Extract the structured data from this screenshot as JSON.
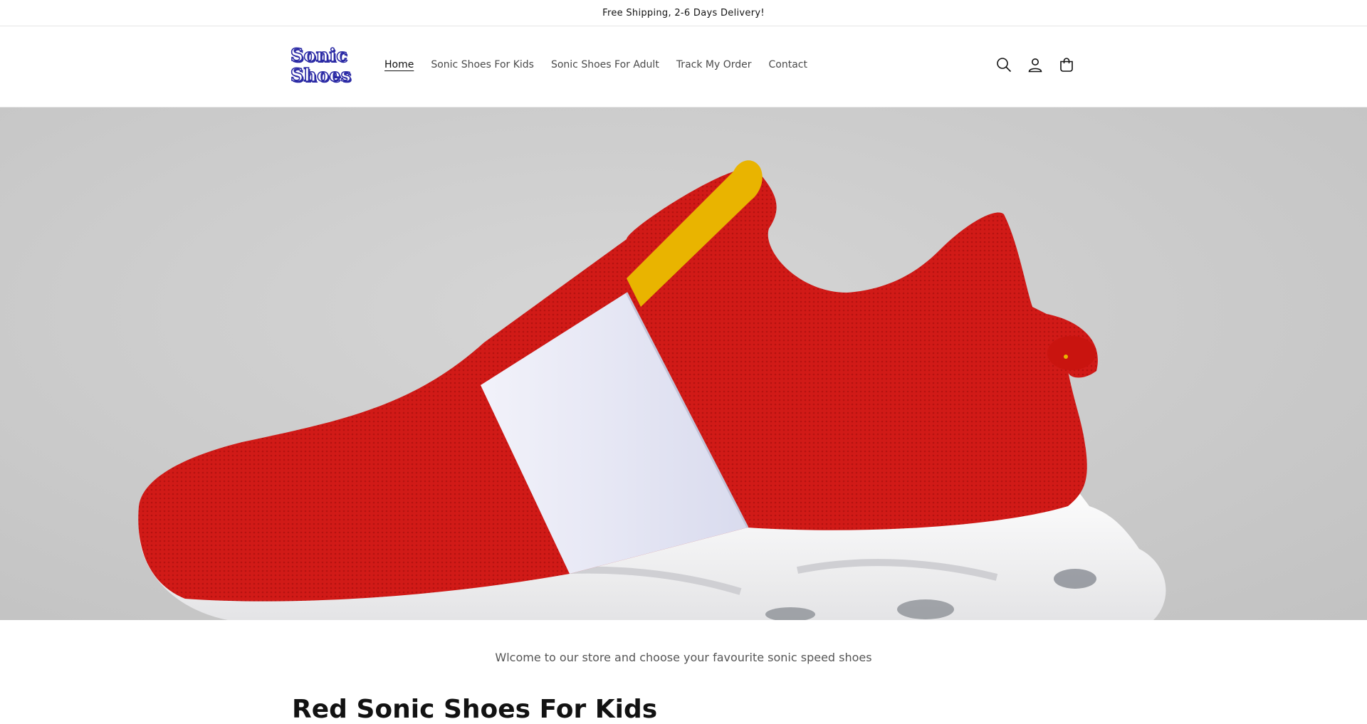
{
  "announcement": {
    "text": "Free Shipping, 2-6 Days Delivery!"
  },
  "header": {
    "logo": {
      "line1": "Sonic",
      "line2": "Shoes"
    },
    "nav": [
      {
        "label": "Home",
        "active": true
      },
      {
        "label": "Sonic Shoes For Kids"
      },
      {
        "label": "Sonic Shoes For Adult"
      },
      {
        "label": "Track My Order"
      },
      {
        "label": "Contact"
      }
    ],
    "icons": [
      "search-icon",
      "account-icon",
      "cart-icon"
    ]
  },
  "hero": {
    "image": "red-white-sonic-sneaker",
    "colors": {
      "background": "#cbcbcb",
      "upper": "#d11a17",
      "strap": "#e6e7f4",
      "sole": "#f2f2f2",
      "tab": "#e9b400"
    }
  },
  "main": {
    "welcome_text": "Wlcome to our store and choose your favourite sonic speed shoes",
    "section_heading": "Red Sonic Shoes For Kids"
  }
}
